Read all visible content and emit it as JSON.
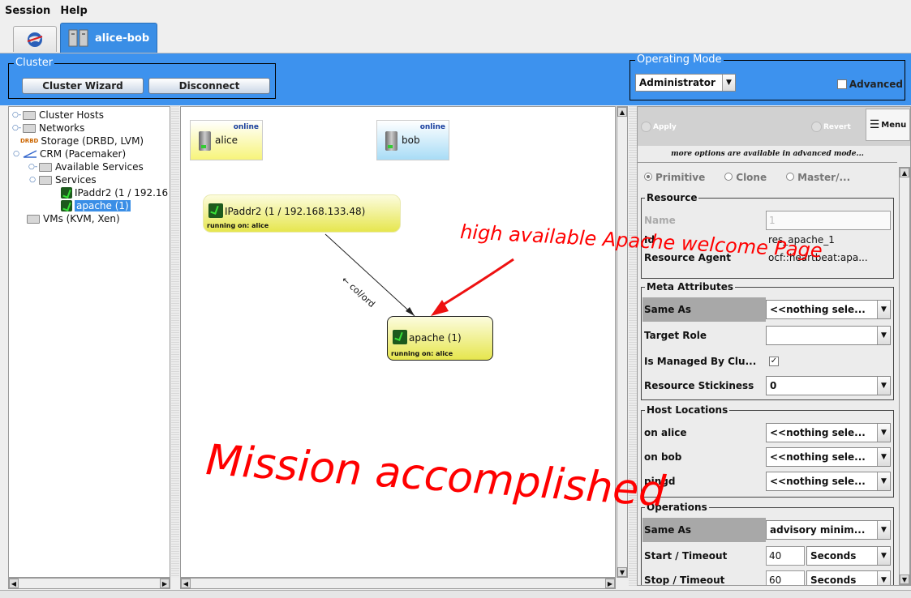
{
  "menubar": {
    "session": "Session",
    "help": "Help"
  },
  "tabs": {
    "active_label": "alice-bob"
  },
  "cluster": {
    "legend": "Cluster",
    "wizard_button": "Cluster Wizard",
    "disconnect_button": "Disconnect"
  },
  "operating_mode": {
    "legend": "Operating Mode",
    "selected": "Administrator",
    "advanced_label": "Advanced"
  },
  "tree": {
    "items": [
      {
        "label": "Cluster Hosts"
      },
      {
        "label": "Networks"
      },
      {
        "label": "Storage (DRBD, LVM)"
      },
      {
        "label": "CRM (Pacemaker)"
      },
      {
        "label": "Available Services"
      },
      {
        "label": "Services"
      },
      {
        "label": "IPaddr2 (1 / 192.16"
      },
      {
        "label": "apache (1)"
      },
      {
        "label": "VMs (KVM, Xen)"
      }
    ]
  },
  "graph": {
    "hosts": [
      {
        "name": "alice",
        "status": "online"
      },
      {
        "name": "bob",
        "status": "online"
      }
    ],
    "services": [
      {
        "name": "IPaddr2 (1 / 192.168.133.48)",
        "running": "running on: alice"
      },
      {
        "name": "apache (1)",
        "running": "running on: alice"
      }
    ],
    "edge_label": "← col/ord"
  },
  "annotations": {
    "callout": "high available Apache welcome Page",
    "stamp": "Mission accomplished"
  },
  "panel": {
    "apply": "Apply",
    "revert": "Revert",
    "menu": "Menu",
    "note": "more options are available in advanced mode...",
    "radios": [
      "Primitive",
      "Clone",
      "Master/..."
    ],
    "resource": {
      "legend": "Resource",
      "name_label": "Name",
      "name_value": "1",
      "id_label": "Id",
      "id_value": "res_apache_1",
      "agent_label": "Resource Agent",
      "agent_value": "ocf::heartbeat:apa..."
    },
    "meta": {
      "legend": "Meta Attributes",
      "same_as_label": "Same As",
      "same_as_value": "<<nothing sele...",
      "target_role_label": "Target Role",
      "target_role_value": "",
      "managed_label": "Is Managed By Clu...",
      "managed_checked": true,
      "stickiness_label": "Resource Stickiness",
      "stickiness_value": "0"
    },
    "hosts": {
      "legend": "Host Locations",
      "rows": [
        {
          "label": "on alice",
          "value": "<<nothing sele..."
        },
        {
          "label": "on bob",
          "value": "<<nothing sele..."
        },
        {
          "label": "pingd",
          "value": "<<nothing sele..."
        }
      ]
    },
    "operations": {
      "legend": "Operations",
      "same_as_label": "Same As",
      "same_as_value": "advisory minim...",
      "rows": [
        {
          "label": "Start / Timeout",
          "value": "40",
          "unit": "Seconds"
        },
        {
          "label": "Stop / Timeout",
          "value": "60",
          "unit": "Seconds"
        }
      ]
    }
  }
}
